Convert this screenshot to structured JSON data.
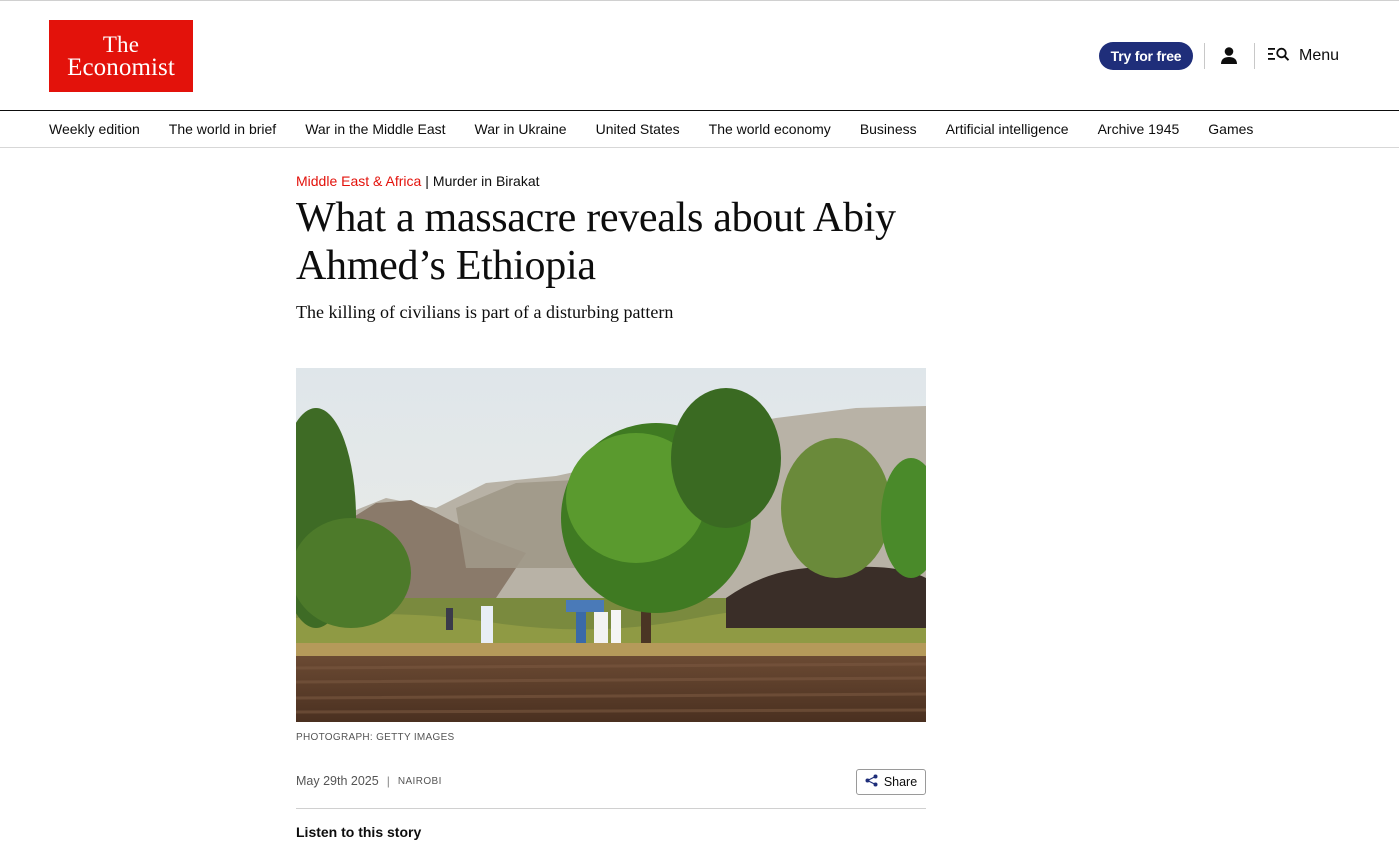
{
  "header": {
    "logo_line1": "The",
    "logo_line2": "Economist",
    "try_button": "Try for free",
    "menu_label": "Menu",
    "brand_color": "#e3120b",
    "button_color": "#1f2e7a"
  },
  "nav": {
    "items": [
      "Weekly edition",
      "The world in brief",
      "War in the Middle East",
      "War in Ukraine",
      "United States",
      "The world economy",
      "Business",
      "Artificial intelligence",
      "Archive 1945",
      "Games"
    ]
  },
  "article": {
    "section": "Middle East & Africa",
    "fly_title": "Murder in Birakat",
    "headline": "What a massacre reveals about Abiy Ahmed’s Ethiopia",
    "standfirst": "The killing of civilians is part of a disturbing pattern",
    "photo_credit": "PHOTOGRAPH: GETTY IMAGES",
    "date": "May 29th 2025",
    "dateline": "NAIROBI",
    "share_label": "Share",
    "listen_label": "Listen to this story"
  },
  "icons": {
    "user": "user-icon",
    "menu": "menu-search-icon",
    "share": "share-icon"
  }
}
